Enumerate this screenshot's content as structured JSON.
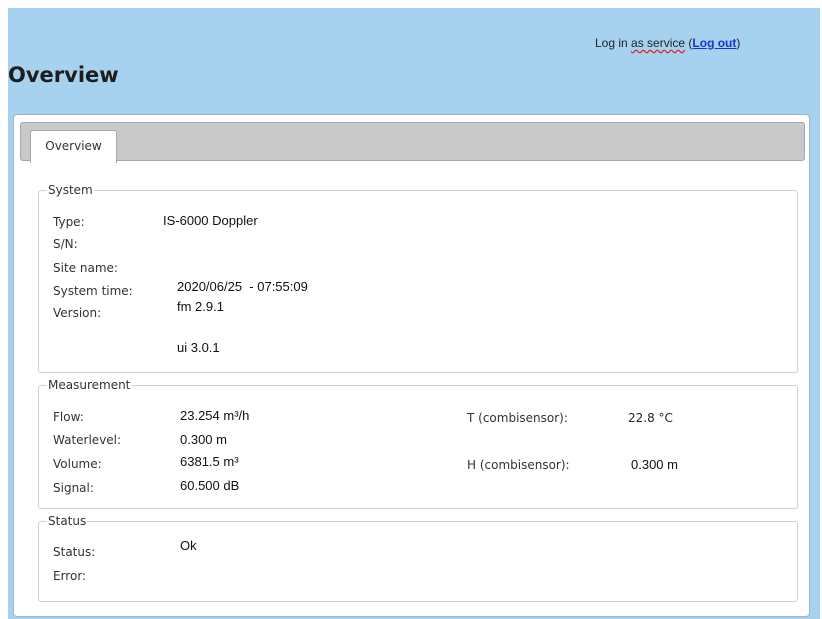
{
  "header": {
    "login_prefix": "Log in ",
    "login_as": "as service",
    "login_open": " (",
    "logout_label": "Log out",
    "login_close": ")",
    "page_title": "Overview"
  },
  "tabs": [
    {
      "label": "Overview"
    }
  ],
  "system": {
    "legend": "System",
    "type_label": "Type:",
    "type_value": "IS-6000 Doppler",
    "sn_label": "S/N:",
    "site_label": "Site name:",
    "time_label": "System time:",
    "time_value": "2020/06/25  - 07:55:09",
    "version_label": "Version:",
    "fm_version": "fm 2.9.1",
    "ui_version": "ui 3.0.1"
  },
  "measurement": {
    "legend": "Measurement",
    "flow_label": "Flow:",
    "flow_value": "23.254 m³/h",
    "waterlevel_label": "Waterlevel:",
    "waterlevel_value": "0.300 m",
    "volume_label": "Volume:",
    "volume_value": "6381.5 m³",
    "signal_label": "Signal:",
    "signal_value": "60.500 dB",
    "t_label": "T (combisensor):",
    "t_value": "22.8 °C",
    "h_label": "H (combisensor):",
    "h_value": "0.300 m"
  },
  "status": {
    "legend": "Status",
    "status_label": "Status:",
    "status_value": "Ok",
    "error_label": "Error:"
  },
  "colors": {
    "header_bg": "#a6d1ef",
    "tabbar_bg": "#c9c9c9",
    "link": "#1a35c8"
  }
}
